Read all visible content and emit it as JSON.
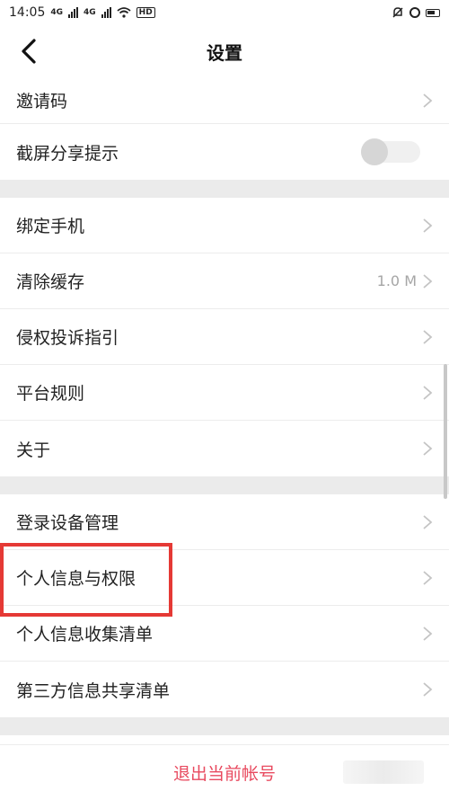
{
  "status_bar": {
    "time": "14:05",
    "net1": "4G",
    "net2": "4G",
    "hd": "HD",
    "icons": [
      "signal-icon",
      "wifi-icon",
      "alarm-icon",
      "sync-icon",
      "battery-icon"
    ]
  },
  "header": {
    "title": "设置",
    "back_icon": "back-arrow-icon"
  },
  "settings": {
    "group1": [
      {
        "label": "邀请码",
        "type": "link"
      },
      {
        "label": "截屏分享提示",
        "type": "toggle",
        "enabled": false
      }
    ],
    "group2": [
      {
        "label": "绑定手机",
        "type": "link"
      },
      {
        "label": "清除缓存",
        "type": "link",
        "value": "1.0 M"
      },
      {
        "label": "侵权投诉指引",
        "type": "link"
      },
      {
        "label": "平台规则",
        "type": "link"
      },
      {
        "label": "关于",
        "type": "link"
      }
    ],
    "group3": [
      {
        "label": "登录设备管理",
        "type": "link"
      },
      {
        "label": "个人信息与权限",
        "type": "link",
        "highlighted": true
      },
      {
        "label": "个人信息收集清单",
        "type": "link"
      },
      {
        "label": "第三方信息共享清单",
        "type": "link"
      }
    ]
  },
  "logout": {
    "label": "退出当前帐号"
  },
  "colors": {
    "accent": "#e84a5f",
    "highlight_box": "#e53935",
    "section_gap": "#ebebeb"
  }
}
